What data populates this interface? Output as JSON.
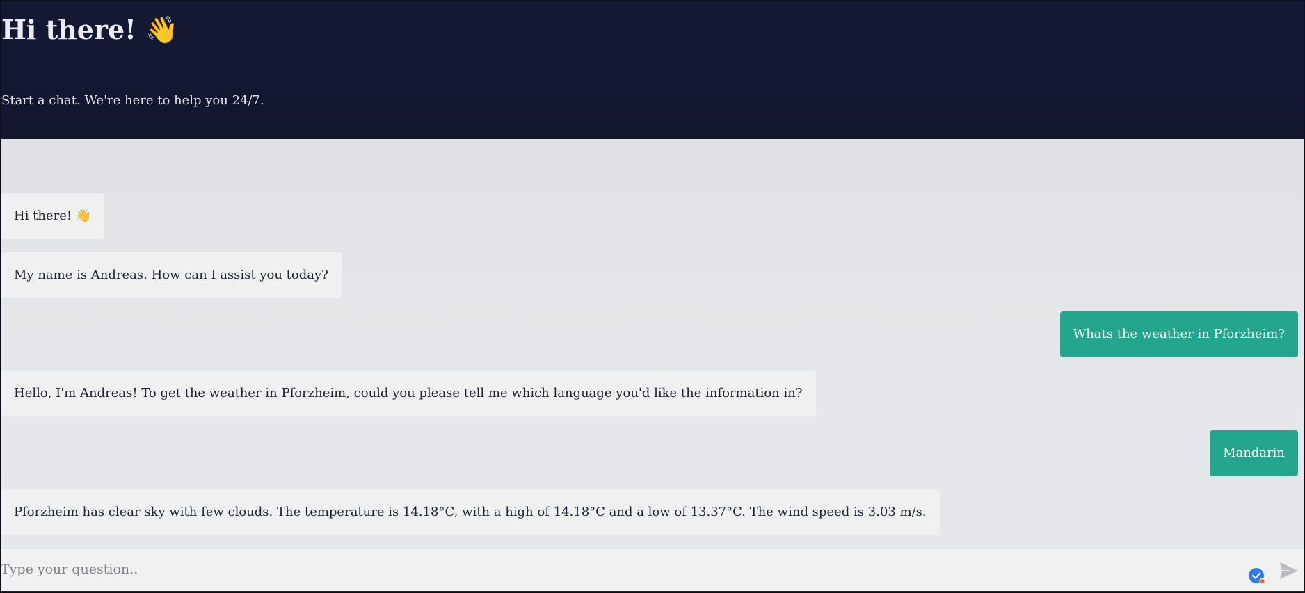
{
  "header": {
    "title": "Hi there! 👋",
    "subtitle": "Start a chat. We're here to help you 24/7."
  },
  "messages": [
    {
      "role": "bot",
      "text": "Hi there! 👋"
    },
    {
      "role": "bot",
      "text": "My name is Andreas. How can I assist you today?"
    },
    {
      "role": "user",
      "text": "Whats the weather in Pforzheim?"
    },
    {
      "role": "bot",
      "text": "Hello, I'm Andreas! To get the weather in Pforzheim, could you please tell me which language you'd like the information in?"
    },
    {
      "role": "user",
      "text": "Mandarin"
    },
    {
      "role": "bot",
      "text": "Pforzheim has clear sky with few clouds. The temperature is 14.18°C, with a high of 14.18°C and a low of 13.37°C. The wind speed is 3.03 m/s."
    }
  ],
  "composer": {
    "placeholder": "Type your question..",
    "value": "",
    "icons": {
      "grammar": "check-badge-icon",
      "send": "send-icon"
    }
  },
  "colors": {
    "header_bg": "#141731",
    "chat_bg": "#e3e5e8",
    "bot_bubble": "#f0f0f1",
    "user_bubble": "#23a58e",
    "badge_blue": "#2b7de9",
    "badge_dot": "#f26b3a"
  }
}
